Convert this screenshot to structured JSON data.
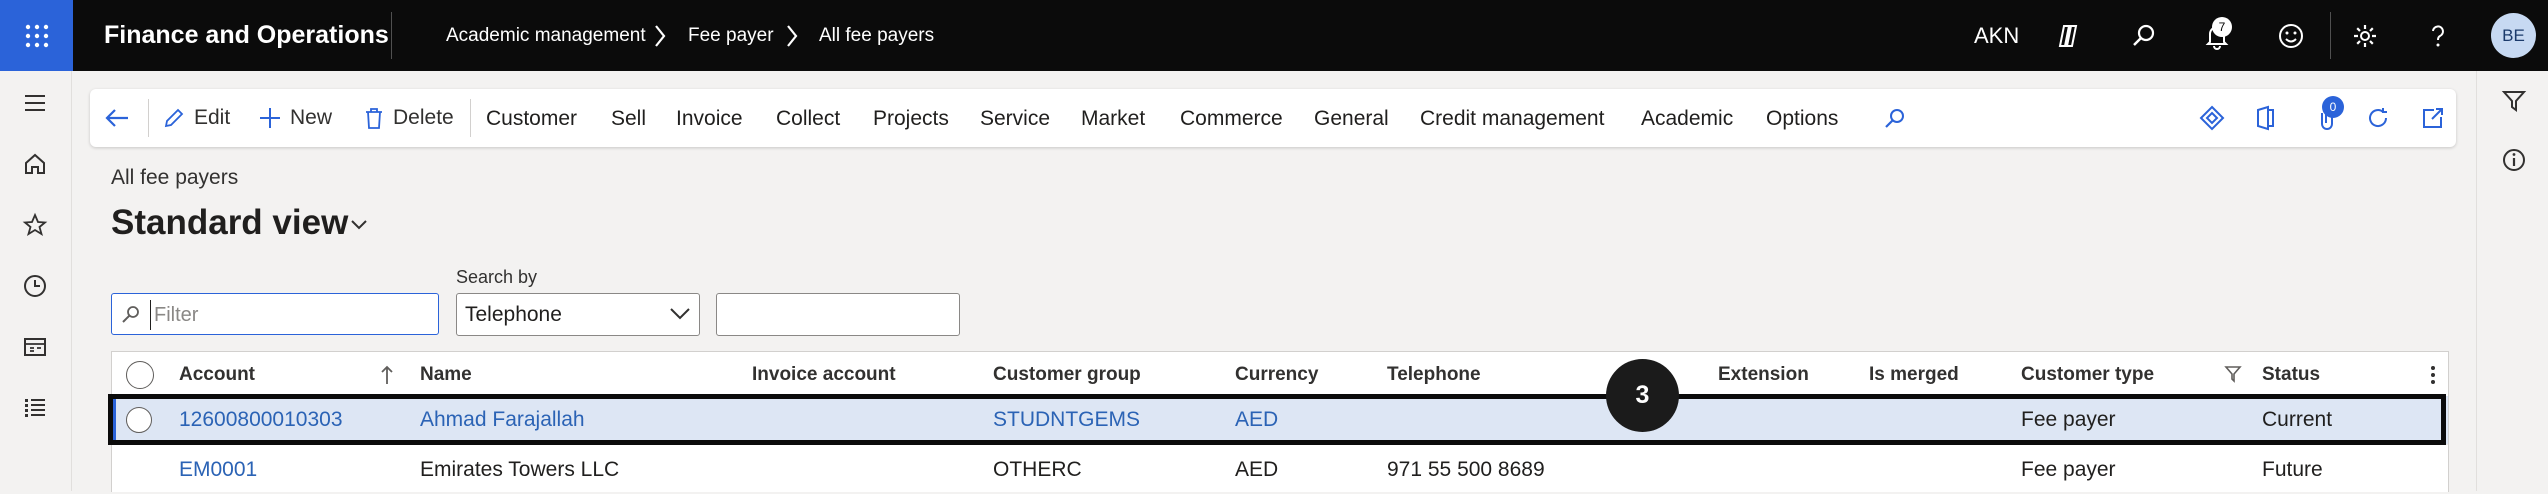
{
  "header": {
    "app_title": "Finance and Operations",
    "breadcrumb": [
      "Academic management",
      "Fee payer",
      "All fee payers"
    ],
    "company": "AKN",
    "notification_count": "7",
    "user_initials": "BE"
  },
  "action_pane": {
    "edit": "Edit",
    "new": "New",
    "delete": "Delete",
    "tabs": [
      "Customer",
      "Sell",
      "Invoice",
      "Collect",
      "Projects",
      "Service",
      "Market",
      "Commerce",
      "General",
      "Credit management",
      "Academic",
      "Options"
    ],
    "attachment_count": "0"
  },
  "page": {
    "breadcrumb": "All fee payers",
    "view_title": "Standard view"
  },
  "filter": {
    "placeholder": "Filter",
    "search_by_label": "Search by",
    "search_by_value": "Telephone",
    "search_value": ""
  },
  "grid": {
    "columns": [
      "Account",
      "Name",
      "Invoice account",
      "Customer group",
      "Currency",
      "Telephone",
      "Extension",
      "Is merged",
      "Customer type",
      "Status"
    ],
    "sort_column": "Account",
    "rows": [
      {
        "account": "12600800010303",
        "name": "Ahmad Farajallah",
        "invoice_account": "",
        "customer_group": "STUDNTGEMS",
        "currency": "AED",
        "telephone": "",
        "extension": "",
        "is_merged": "",
        "customer_type": "Fee payer",
        "status": "Current",
        "selected": true
      },
      {
        "account": "EM0001",
        "name": "Emirates Towers LLC",
        "invoice_account": "",
        "customer_group": "OTHERC",
        "currency": "AED",
        "telephone": "971 55 500 8689",
        "extension": "",
        "is_merged": "",
        "customer_type": "Fee payer",
        "status": "Future",
        "selected": false
      }
    ]
  },
  "annotation": {
    "step_number": "3"
  },
  "colors": {
    "topbar": "#0b0b0b",
    "waffle": "#2b63d9",
    "accent": "#2b63d9",
    "link": "#2b63b5",
    "selected_row": "#dde6f4"
  }
}
